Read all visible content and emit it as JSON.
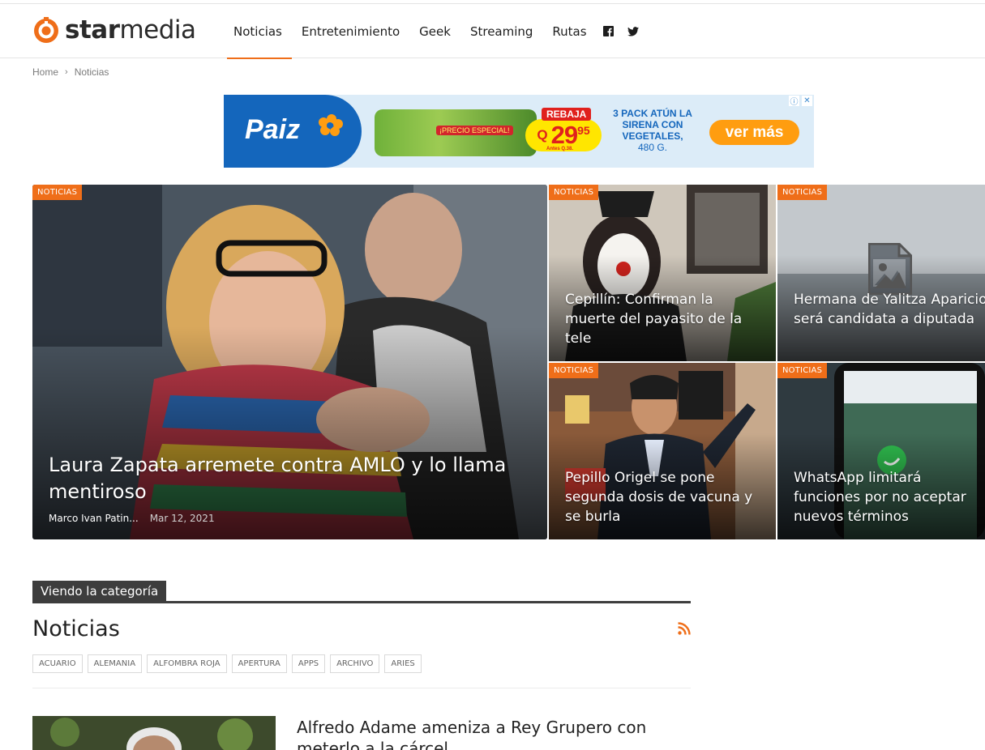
{
  "brand": {
    "name_part1": "star",
    "name_part2": "media"
  },
  "nav": {
    "items": [
      "Noticias",
      "Entretenimiento",
      "Geek",
      "Streaming",
      "Rutas"
    ],
    "active": "Noticias",
    "social": [
      "facebook-icon",
      "twitter-icon"
    ]
  },
  "breadcrumb": {
    "home": "Home",
    "current": "Noticias"
  },
  "ad": {
    "brand": "Paiz",
    "product_badge": "¡PRECIO ESPECIAL!",
    "rebaja": "REBAJA",
    "currency": "Q",
    "price": "29",
    "cents": "95",
    "antes": "Antes Q.38.",
    "desc_line1": "3 PACK ATÚN LA SIRENA CON VEGETALES,",
    "desc_line2": "480 G.",
    "cta": "ver más",
    "info_icon": "ⓘ",
    "close_icon": "✕"
  },
  "hero": {
    "main": {
      "tag": "NOTICIAS",
      "title": "Laura Zapata arremete contra AMLO y lo llama mentiroso",
      "author": "Marco Ivan Patin...",
      "date": "Mar 12, 2021"
    },
    "cards": [
      {
        "tag": "NOTICIAS",
        "title": "Cepillín: Confirman la muerte del payasito de la tele"
      },
      {
        "tag": "NOTICIAS",
        "title": "Hermana de Yalitza Aparicio será candidata a diputada"
      },
      {
        "tag": "NOTICIAS",
        "title": "Pepillo Origel se pone segunda dosis de vacuna y se burla"
      },
      {
        "tag": "NOTICIAS",
        "title": "WhatsApp limitará funciones por no aceptar nuevos términos"
      }
    ]
  },
  "section": {
    "label": "Viendo la categoría",
    "title": "Noticias",
    "tags": [
      "ACUARIO",
      "ALEMANIA",
      "ALFOMBRA ROJA",
      "APERTURA",
      "APPS",
      "ARCHIVO",
      "ARIES"
    ]
  },
  "posts": [
    {
      "title": "Alfredo Adame ameniza a Rey Grupero con meterlo a la cárcel"
    }
  ],
  "colors": {
    "accent": "#ef6e19",
    "dark": "#3d3d3d",
    "ad_blue": "#1466bc"
  }
}
